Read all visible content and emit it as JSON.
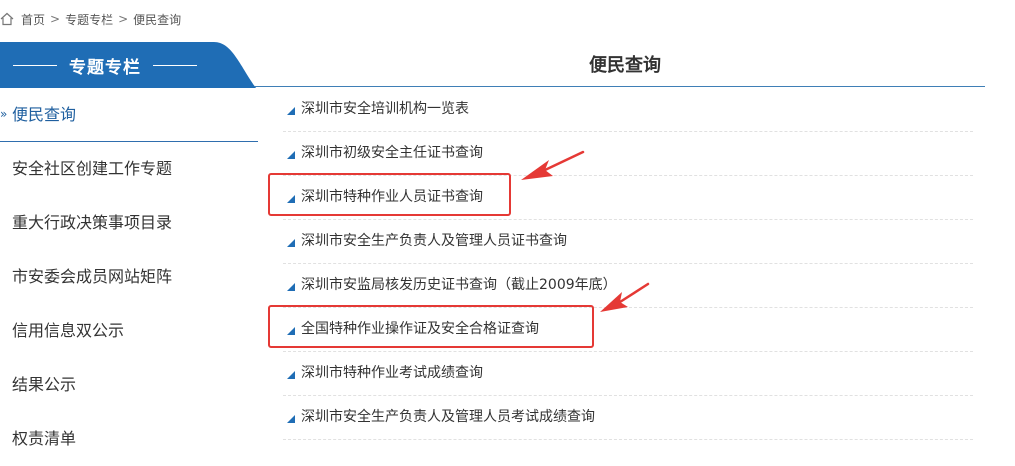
{
  "breadcrumb": {
    "home": "首页",
    "separator": ">",
    "section": "专题专栏",
    "current": "便民查询"
  },
  "sidebar": {
    "title": "专题专栏",
    "active_marker": "»",
    "items": [
      {
        "label": "便民查询",
        "active": true
      },
      {
        "label": "安全社区创建工作专题",
        "active": false
      },
      {
        "label": "重大行政决策事项目录",
        "active": false
      },
      {
        "label": "市安委会成员网站矩阵",
        "active": false
      },
      {
        "label": "信用信息双公示",
        "active": false
      },
      {
        "label": "结果公示",
        "active": false
      },
      {
        "label": "权责清单",
        "active": false
      }
    ]
  },
  "main": {
    "title": "便民查询",
    "links": [
      {
        "label": "深圳市安全培训机构一览表",
        "highlighted": false
      },
      {
        "label": "深圳市初级安全主任证书查询",
        "highlighted": false
      },
      {
        "label": "深圳市特种作业人员证书查询",
        "highlighted": true
      },
      {
        "label": "深圳市安全生产负责人及管理人员证书查询",
        "highlighted": false
      },
      {
        "label": "深圳市安监局核发历史证书查询（截止2009年底）",
        "highlighted": false
      },
      {
        "label": "全国特种作业操作证及安全合格证查询",
        "highlighted": true
      },
      {
        "label": "深圳市特种作业考试成绩查询",
        "highlighted": false
      },
      {
        "label": "深圳市安全生产负责人及管理人员考试成绩查询",
        "highlighted": false
      }
    ]
  },
  "colors": {
    "brand_blue": "#1f6db5",
    "annotation_red": "#e53935"
  }
}
